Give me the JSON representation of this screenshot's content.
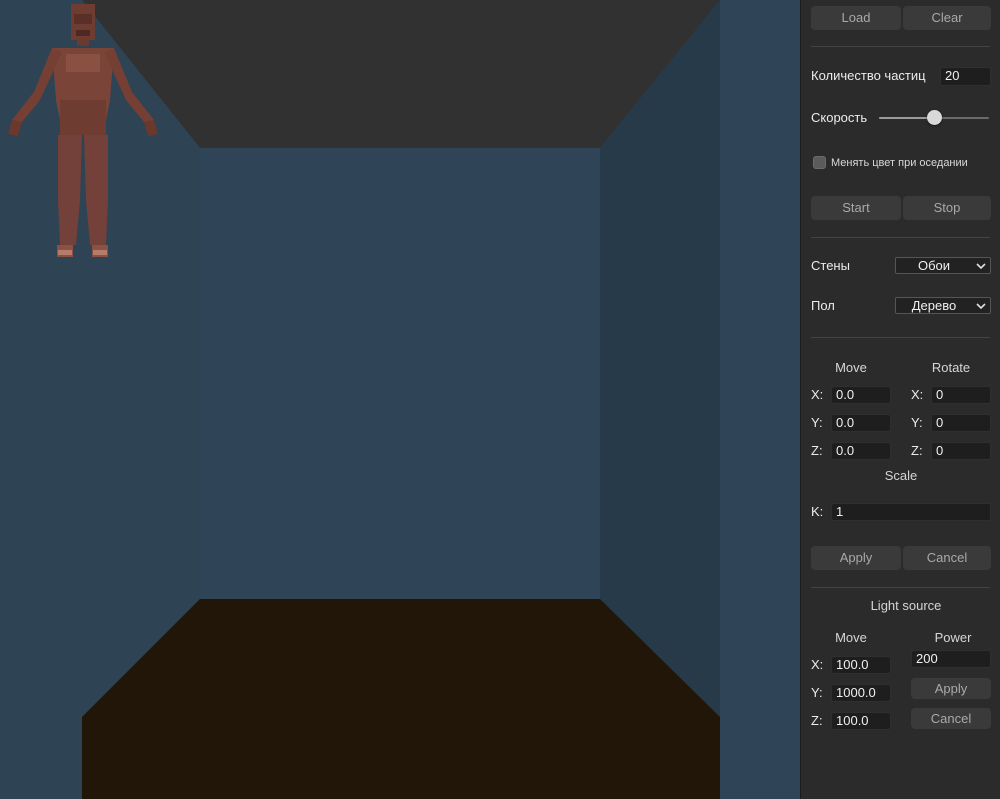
{
  "scene": {
    "colors": {
      "ceiling": "#313131",
      "back_wall": "#2f4456",
      "left_wall": "#2e4354",
      "right_wall": "#273a4a",
      "floor": "#211608",
      "figure": "#7a4438"
    },
    "model": "humanoid"
  },
  "panel": {
    "file": {
      "load_label": "Load",
      "clear_label": "Clear"
    },
    "particles": {
      "count_label": "Количество частиц",
      "count_value": "20",
      "speed_label": "Скорость",
      "speed_value": 0.5,
      "color_change_label": "Менять цвет при оседании",
      "color_change_checked": false,
      "start_label": "Start",
      "stop_label": "Stop"
    },
    "materials": {
      "walls_label": "Стены",
      "walls_value": "Обои",
      "floor_label": "Пол",
      "floor_value": "Дерево"
    },
    "transform": {
      "move_title": "Move",
      "rotate_title": "Rotate",
      "move": {
        "x_label": "X:",
        "x": "0.0",
        "y_label": "Y:",
        "y": "0.0",
        "z_label": "Z:",
        "z": "0.0"
      },
      "rotate": {
        "x_label": "X:",
        "x": "0",
        "y_label": "Y:",
        "y": "0",
        "z_label": "Z:",
        "z": "0"
      },
      "scale_title": "Scale",
      "k_label": "K:",
      "k": "1",
      "apply_label": "Apply",
      "cancel_label": "Cancel"
    },
    "light": {
      "title": "Light source",
      "move_title": "Move",
      "power_title": "Power",
      "power_value": "200",
      "x_label": "X:",
      "x": "100.0",
      "y_label": "Y:",
      "y": "1000.0",
      "z_label": "Z:",
      "z": "100.0",
      "apply_label": "Apply",
      "cancel_label": "Cancel"
    }
  }
}
